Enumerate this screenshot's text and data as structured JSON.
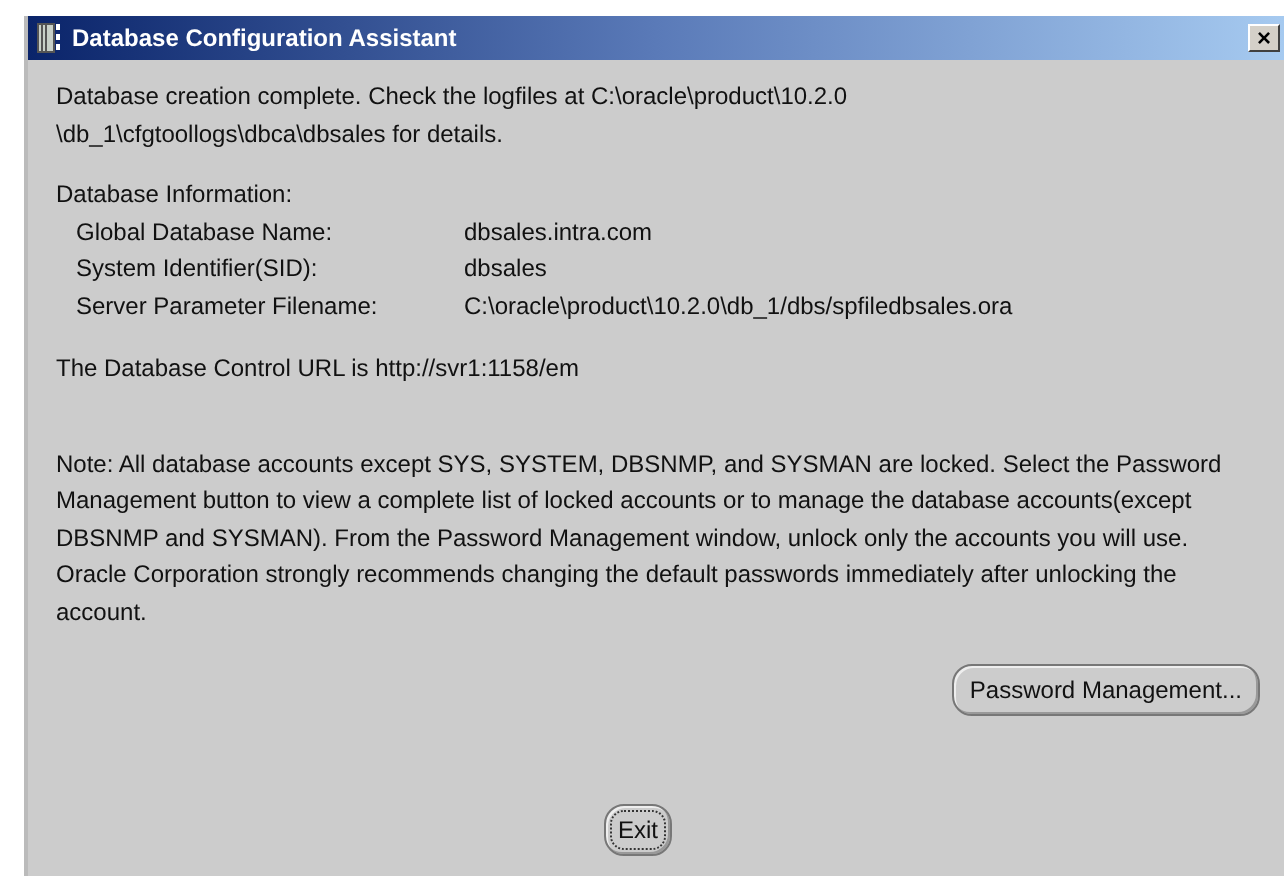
{
  "window": {
    "title": "Database Configuration Assistant",
    "close": "×"
  },
  "message": "Database creation complete. Check the logfiles at C:\\oracle\\product\\10.2.0\n\\db_1\\cfgtoollogs\\dbca\\dbsales for details.",
  "info_heading": "Database Information:",
  "info_rows": [
    {
      "label": "Global Database Name:",
      "value": "dbsales.intra.com"
    },
    {
      "label": "System Identifier(SID):",
      "value": "dbsales"
    },
    {
      "label": "Server Parameter Filename:",
      "value": "C:\\oracle\\product\\10.2.0\\db_1/dbs/spfiledbsales.ora"
    }
  ],
  "url_text": "The Database Control URL is http://svr1:1158/em",
  "note": "Note: All database accounts except SYS, SYSTEM, DBSNMP, and SYSMAN are locked. Select the Password Management button to view a complete list of locked accounts or to manage the database accounts(except DBSNMP and SYSMAN). From the Password Management window, unlock only the accounts you will use. Oracle Corporation strongly recommends changing the default passwords immediately after unlocking the account.",
  "buttons": [
    {
      "label": "Password Management...",
      "kind": "side",
      "focused": false
    },
    {
      "label": "Exit",
      "kind": "center",
      "focused": true
    }
  ]
}
